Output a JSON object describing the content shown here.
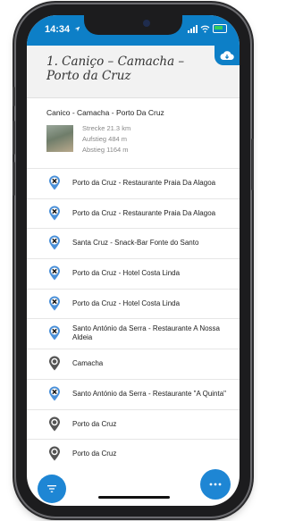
{
  "status": {
    "time": "14:34",
    "location_icon": "location-arrow-icon",
    "battery_color": "#35d05a"
  },
  "colors": {
    "accent": "#0d7fc7",
    "fab": "#1e86d4",
    "pin_blue": "#4a90d9",
    "pin_gray": "#555555"
  },
  "header": {
    "title": "1. Caniço – Camacha – Porto da Cruz"
  },
  "route": {
    "name": "Canico - Camacha - Porto Da Cruz",
    "stats": [
      "Strecke 21.3 km",
      "Aufstieg 484 m",
      "Abstieg 1164 m"
    ]
  },
  "items": [
    {
      "label": "Porto da Cruz - Restaurante Praia Da Alagoa",
      "icon": "restaurant-pin-icon"
    },
    {
      "label": "Porto da Cruz - Restaurante Praia Da Alagoa",
      "icon": "restaurant-pin-icon"
    },
    {
      "label": "Santa Cruz - Snack-Bar Fonte do Santo",
      "icon": "restaurant-pin-icon"
    },
    {
      "label": "Porto da Cruz - Hotel Costa Linda",
      "icon": "restaurant-pin-icon"
    },
    {
      "label": "Porto da Cruz - Hotel Costa Linda",
      "icon": "restaurant-pin-icon"
    },
    {
      "label": "Santo António da Serra - Restaurante A Nossa Aldeia",
      "icon": "restaurant-pin-icon"
    },
    {
      "label": "Camacha",
      "icon": "place-pin-icon"
    },
    {
      "label": "Santo António da Serra - Restaurante \"A Quinta\"",
      "icon": "restaurant-pin-icon"
    },
    {
      "label": "Porto da Cruz",
      "icon": "place-pin-icon"
    },
    {
      "label": "Porto da Cruz",
      "icon": "place-pin-icon"
    }
  ],
  "buttons": {
    "filter_icon": "filter-icon",
    "more_icon": "more-icon",
    "cloud_icon": "cloud-download-icon"
  }
}
